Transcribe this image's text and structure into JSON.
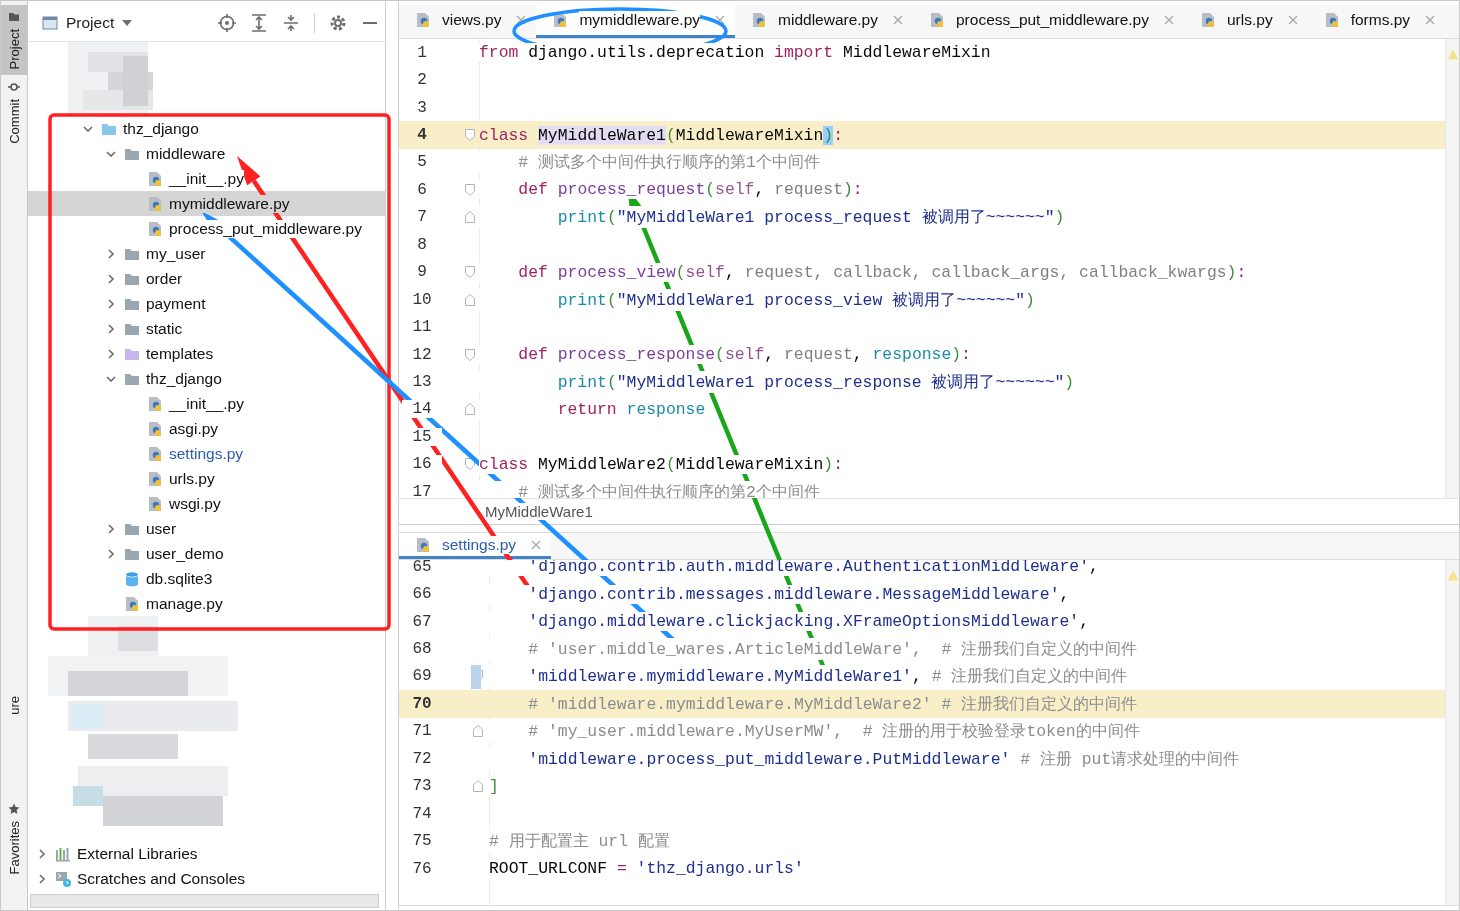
{
  "tool_stripe": [
    {
      "label": "Project",
      "selected": true
    },
    {
      "label": "Commit",
      "selected": false
    },
    {
      "label": "ure",
      "selected": false
    },
    {
      "label": "Favorites",
      "selected": false
    }
  ],
  "project_panel": {
    "title": "Project",
    "tree": [
      {
        "label": "thz_django",
        "kind": "root-folder",
        "expanded": true,
        "selected": false,
        "modified": false,
        "children": [
          {
            "label": "middleware",
            "kind": "folder",
            "expanded": true,
            "selected": false,
            "modified": false,
            "children": [
              {
                "label": "__init__.py",
                "kind": "python",
                "selected": false,
                "modified": false
              },
              {
                "label": "mymiddleware.py",
                "kind": "python",
                "selected": true,
                "modified": false
              },
              {
                "label": "process_put_middleware.py",
                "kind": "python",
                "selected": false,
                "modified": false
              }
            ]
          },
          {
            "label": "my_user",
            "kind": "folder",
            "expanded": false,
            "selected": false,
            "modified": false
          },
          {
            "label": "order",
            "kind": "folder",
            "expanded": false,
            "selected": false,
            "modified": false
          },
          {
            "label": "payment",
            "kind": "folder",
            "expanded": false,
            "selected": false,
            "modified": false
          },
          {
            "label": "static",
            "kind": "folder",
            "expanded": false,
            "selected": false,
            "modified": false
          },
          {
            "label": "templates",
            "kind": "resource-folder",
            "expanded": false,
            "selected": false,
            "modified": false
          },
          {
            "label": "thz_django",
            "kind": "folder",
            "expanded": true,
            "selected": false,
            "modified": false,
            "children": [
              {
                "label": "__init__.py",
                "kind": "python",
                "selected": false,
                "modified": false
              },
              {
                "label": "asgi.py",
                "kind": "python",
                "selected": false,
                "modified": false
              },
              {
                "label": "settings.py",
                "kind": "python",
                "selected": false,
                "modified": true
              },
              {
                "label": "urls.py",
                "kind": "python",
                "selected": false,
                "modified": false
              },
              {
                "label": "wsgi.py",
                "kind": "python",
                "selected": false,
                "modified": false
              }
            ]
          },
          {
            "label": "user",
            "kind": "folder",
            "expanded": false,
            "selected": false,
            "modified": false
          },
          {
            "label": "user_demo",
            "kind": "folder",
            "expanded": false,
            "selected": false,
            "modified": false
          },
          {
            "label": "db.sqlite3",
            "kind": "database",
            "selected": false,
            "modified": false
          },
          {
            "label": "manage.py",
            "kind": "python",
            "selected": false,
            "modified": false
          }
        ]
      }
    ],
    "bottom_items": [
      {
        "label": "External Libraries",
        "kind": "libraries",
        "expanded": false,
        "selected": false,
        "modified": false
      },
      {
        "label": "Scratches and Consoles",
        "kind": "scratches",
        "expanded": false,
        "selected": false,
        "modified": false
      }
    ]
  },
  "editor_tabs": [
    {
      "label": "views.py",
      "selected": false
    },
    {
      "label": "mymiddleware.py",
      "selected": true
    },
    {
      "label": "middleware.py",
      "selected": false
    },
    {
      "label": "process_put_middleware.py",
      "selected": false
    },
    {
      "label": "urls.py",
      "selected": false
    },
    {
      "label": "forms.py",
      "selected": false
    }
  ],
  "editor": {
    "lines": [
      {
        "number": "1",
        "kind": "plain",
        "current": false,
        "tokens": [
          {
            "kind": "kw",
            "text": "from"
          },
          {
            "kind": "plain",
            "text": " django.utils.deprecation "
          },
          {
            "kind": "kw",
            "text": "import"
          },
          {
            "kind": "plain",
            "text": " MiddlewareMixin"
          }
        ]
      },
      {
        "number": "2",
        "kind": "plain",
        "current": false
      },
      {
        "number": "3",
        "kind": "plain",
        "current": false
      },
      {
        "number": "4",
        "kind": "fold-start",
        "current": true,
        "tokens": [
          {
            "kind": "kw",
            "text": "class "
          },
          {
            "kind": "usage",
            "text": "MyMiddleWare1"
          },
          {
            "kind": "punct",
            "text": "("
          },
          {
            "kind": "plain",
            "text": "MiddlewareMixin"
          },
          {
            "kind": "brace",
            "text": ")"
          },
          {
            "kind": "kw",
            "text": ":"
          }
        ]
      },
      {
        "number": "5",
        "kind": "plain",
        "current": false,
        "tokens": [
          {
            "kind": "cmt",
            "text": "    # 测试多个中间件执行顺序的第1个中间件"
          }
        ]
      },
      {
        "number": "6",
        "kind": "fold-start",
        "current": false,
        "tokens": [
          {
            "kind": "kw",
            "text": "    def "
          },
          {
            "kind": "fn",
            "text": "process_request"
          },
          {
            "kind": "punct",
            "text": "("
          },
          {
            "kind": "self",
            "text": "self"
          },
          {
            "kind": "plain",
            "text": ", "
          },
          {
            "kind": "param",
            "text": "request"
          },
          {
            "kind": "punct",
            "text": ")"
          },
          {
            "kind": "kw",
            "text": ":"
          }
        ]
      },
      {
        "number": "7",
        "kind": "fold-end",
        "current": false,
        "tokens": [
          {
            "kind": "builtin",
            "text": "        print"
          },
          {
            "kind": "punct",
            "text": "("
          },
          {
            "kind": "str",
            "text": "\"MyMiddleWare1 process_request 被调用了~~~~~~\""
          },
          {
            "kind": "punct",
            "text": ")"
          }
        ]
      },
      {
        "number": "8",
        "kind": "plain",
        "current": false
      },
      {
        "number": "9",
        "kind": "fold-start",
        "current": false,
        "tokens": [
          {
            "kind": "kw",
            "text": "    def "
          },
          {
            "kind": "fn",
            "text": "process_view"
          },
          {
            "kind": "punct",
            "text": "("
          },
          {
            "kind": "self",
            "text": "self"
          },
          {
            "kind": "plain",
            "text": ", "
          },
          {
            "kind": "param",
            "text": "request, callback, callback_args, callback_kwargs"
          },
          {
            "kind": "punct",
            "text": ")"
          },
          {
            "kind": "kw",
            "text": ":"
          }
        ]
      },
      {
        "number": "10",
        "kind": "fold-end",
        "current": false,
        "tokens": [
          {
            "kind": "builtin",
            "text": "        print"
          },
          {
            "kind": "punct",
            "text": "("
          },
          {
            "kind": "str",
            "text": "\"MyMiddleWare1 process_view 被调用了~~~~~~\""
          },
          {
            "kind": "punct",
            "text": ")"
          }
        ]
      },
      {
        "number": "11",
        "kind": "plain",
        "current": false
      },
      {
        "number": "12",
        "kind": "fold-start",
        "current": false,
        "tokens": [
          {
            "kind": "kw",
            "text": "    def "
          },
          {
            "kind": "fn",
            "text": "process_response"
          },
          {
            "kind": "punct",
            "text": "("
          },
          {
            "kind": "self",
            "text": "self"
          },
          {
            "kind": "plain",
            "text": ", "
          },
          {
            "kind": "param",
            "text": "request"
          },
          {
            "kind": "plain",
            "text": ", "
          },
          {
            "kind": "var",
            "text": "response"
          },
          {
            "kind": "punct",
            "text": ")"
          },
          {
            "kind": "kw",
            "text": ":"
          }
        ]
      },
      {
        "number": "13",
        "kind": "plain",
        "current": false,
        "tokens": [
          {
            "kind": "builtin",
            "text": "        print"
          },
          {
            "kind": "punct",
            "text": "("
          },
          {
            "kind": "str",
            "text": "\"MyMiddleWare1 process_response 被调用了~~~~~~\""
          },
          {
            "kind": "punct",
            "text": ")"
          }
        ]
      },
      {
        "number": "14",
        "kind": "fold-end",
        "current": false,
        "tokens": [
          {
            "kind": "kw",
            "text": "        return "
          },
          {
            "kind": "var",
            "text": "response"
          }
        ]
      },
      {
        "number": "15",
        "kind": "plain",
        "current": false
      },
      {
        "number": "16",
        "kind": "fold-start",
        "current": false,
        "tokens": [
          {
            "kind": "kw",
            "text": "class "
          },
          {
            "kind": "plain",
            "text": "MyMiddleWare2"
          },
          {
            "kind": "punct",
            "text": "("
          },
          {
            "kind": "plain",
            "text": "MiddlewareMixin"
          },
          {
            "kind": "punct",
            "text": ")"
          },
          {
            "kind": "kw",
            "text": ":"
          }
        ]
      },
      {
        "number": "17",
        "kind": "plain",
        "current": false,
        "tokens": [
          {
            "kind": "cmt",
            "text": "    # 测试多个中间件执行顺序的第2个中间件"
          }
        ]
      }
    ],
    "breadcrumb": "MyMiddleWare1"
  },
  "lower_tabs": [
    {
      "label": "settings.py",
      "selected": true
    }
  ],
  "lower_editor": {
    "lines": [
      {
        "number": "65",
        "kind": "plain",
        "current": false,
        "tokens": [
          {
            "kind": "str",
            "text": "    'django.contrib.auth.middleware.AuthenticationMiddleware'"
          },
          {
            "kind": "plain",
            "text": ","
          }
        ]
      },
      {
        "number": "66",
        "kind": "plain",
        "current": false,
        "tokens": [
          {
            "kind": "str",
            "text": "    'django.contrib.messages.middleware.MessageMiddleware'"
          },
          {
            "kind": "plain",
            "text": ","
          }
        ]
      },
      {
        "number": "67",
        "kind": "plain",
        "current": false,
        "tokens": [
          {
            "kind": "str",
            "text": "    'django.middleware.clickjacking.XFrameOptionsMiddleware'"
          },
          {
            "kind": "plain",
            "text": ","
          }
        ]
      },
      {
        "number": "68",
        "kind": "plain",
        "current": false,
        "tokens": [
          {
            "kind": "cmt",
            "text": "    # 'user.middle_wares.ArticleMiddleWare',  # 注册我们自定义的中间件"
          }
        ]
      },
      {
        "number": "69",
        "kind": "fold-start",
        "current": false,
        "changed": true,
        "tokens": [
          {
            "kind": "str",
            "text": "    'middleware.mymiddleware.MyMiddleWare1'"
          },
          {
            "kind": "plain",
            "text": ","
          },
          {
            "kind": "cmt",
            "text": " # 注册我们自定义的中间件"
          }
        ]
      },
      {
        "number": "70",
        "kind": "plain",
        "current": true,
        "tokens": [
          {
            "kind": "cmt",
            "text": "    # 'middleware.mymiddleware.MyMiddleWare2' # 注册我们自定义的中间件"
          }
        ]
      },
      {
        "number": "71",
        "kind": "fold-end",
        "current": false,
        "tokens": [
          {
            "kind": "cmt",
            "text": "    # 'my_user.middleware.MyUserMW',  # 注册的用于校验登录token的中间件"
          }
        ]
      },
      {
        "number": "72",
        "kind": "plain",
        "current": false,
        "tokens": [
          {
            "kind": "str",
            "text": "    'middleware.process_put_middleware.PutMiddleware'"
          },
          {
            "kind": "cmt",
            "text": " # 注册 put请求处理的中间件"
          }
        ]
      },
      {
        "number": "73",
        "kind": "fold-end",
        "current": false,
        "tokens": [
          {
            "kind": "punct",
            "text": "]"
          }
        ]
      },
      {
        "number": "74",
        "kind": "plain",
        "current": false
      },
      {
        "number": "75",
        "kind": "plain",
        "current": false,
        "tokens": [
          {
            "kind": "cmt",
            "text": "# 用于配置主 url 配置"
          }
        ]
      },
      {
        "number": "76",
        "kind": "plain",
        "current": false,
        "tokens": [
          {
            "kind": "plain",
            "text": "ROOT_URLCONF "
          },
          {
            "kind": "kw",
            "text": "="
          },
          {
            "kind": "str",
            "text": " 'thz_django.urls'"
          }
        ]
      }
    ]
  },
  "annotations": [
    {
      "kind": "rectangle",
      "color": "#ff2020"
    },
    {
      "kind": "ellipse",
      "color": "#1e90ff"
    },
    {
      "kind": "arrow",
      "color": "#ff2020"
    },
    {
      "kind": "arrow",
      "color": "#1e90ff"
    },
    {
      "kind": "arrow",
      "color": "#1aa61a"
    }
  ]
}
